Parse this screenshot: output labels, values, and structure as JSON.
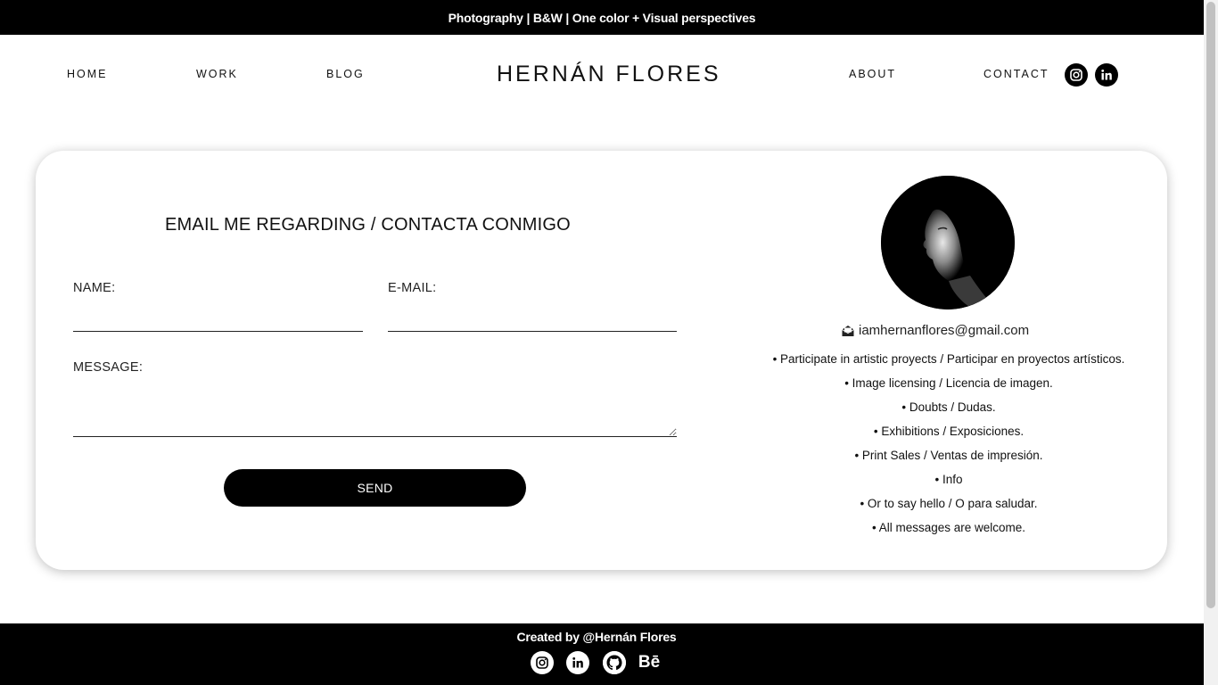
{
  "topbar": {
    "tagline": "Photography | B&W | One color + Visual perspectives"
  },
  "nav": {
    "items": [
      {
        "label": "HOME"
      },
      {
        "label": "WORK"
      },
      {
        "label": "BLOG"
      },
      {
        "label": "ABOUT"
      },
      {
        "label": "CONTACT"
      }
    ],
    "brand": "HERNÁN FLORES",
    "social_icons": [
      "instagram-icon",
      "linkedin-icon"
    ]
  },
  "contact_form": {
    "title": "EMAIL ME REGARDING / CONTACTA CONMIGO",
    "name_label": "NAME:",
    "name_value": "",
    "email_label": "E-MAIL:",
    "email_value": "",
    "message_label": "MESSAGE:",
    "message_value": "",
    "send_label": "SEND"
  },
  "profile": {
    "email": "iamhernanflores@gmail.com",
    "email_icon": "envelope-open-icon",
    "topics": [
      "• Participate in artistic proyects / Participar en proyectos artísticos.",
      "• Image licensing / Licencia de imagen.",
      "• Doubts / Dudas.",
      "• Exhibitions / Exposiciones.",
      "• Print Sales / Ventas de impresión.",
      "• Info",
      "• Or to say hello / O para saludar.",
      "• All messages are welcome."
    ]
  },
  "footer": {
    "credit": "Created by @Hernán Flores",
    "icons": [
      "instagram-icon",
      "linkedin-icon",
      "github-icon",
      "behance-icon"
    ],
    "behance_text": "Bē"
  },
  "colors": {
    "background": "#ffffff",
    "bars": "#000000",
    "text": "#111111"
  }
}
